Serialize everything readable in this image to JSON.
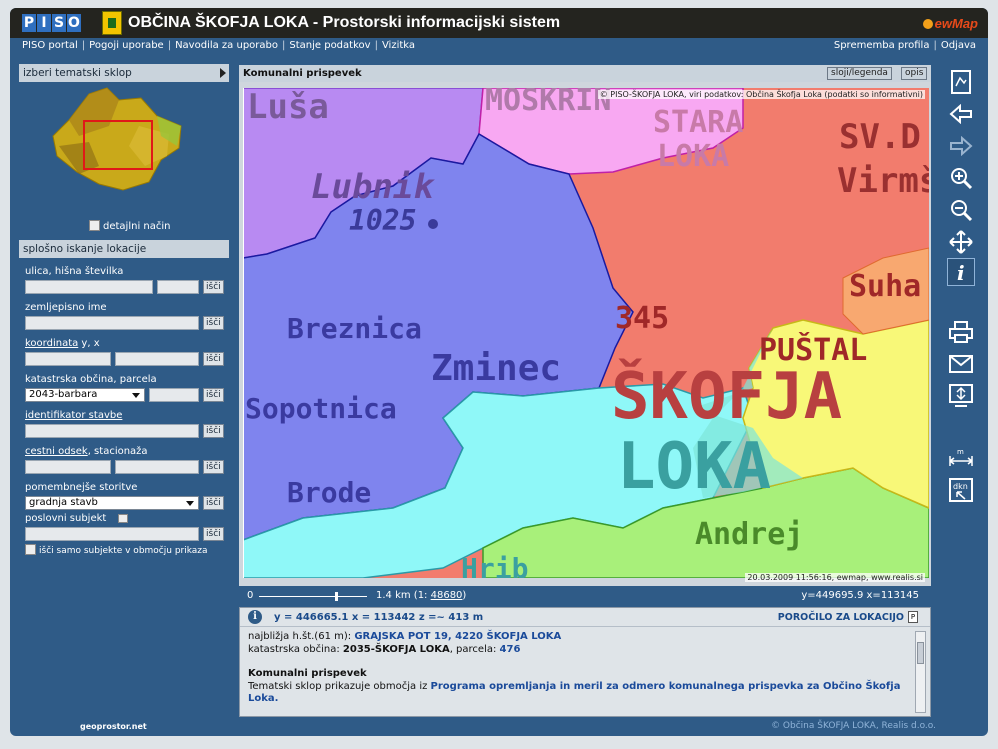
{
  "header": {
    "logo_letters": [
      "P",
      "I",
      "S",
      "O"
    ],
    "title": "OBČINA ŠKOFJA LOKA",
    "subtitle": " - Prostorski informacijski sistem",
    "brand": "ewMap"
  },
  "topnav": {
    "left": [
      "PISO portal",
      "Pogoji uporabe",
      "Navodila za uporabo",
      "Stanje podatkov",
      "Vizitka"
    ],
    "right": [
      "Sprememba profila",
      "Odjava"
    ]
  },
  "left": {
    "thematic_label": "izberi tematski sklop",
    "detail_mode": "detajlni način",
    "search_title": "splošno iskanje lokacije",
    "search_btn": "išči",
    "fields": {
      "street": "ulica, hišna številka",
      "toponym": "zemljepisno ime",
      "coord_link": "koordinata",
      "coord_suffix": " y, x",
      "cadastral": "katastrska občina, parcela",
      "cadastral_value": "2043-barbara",
      "building_id": "identifikator stavbe",
      "road_link": "cestni odsek",
      "road_suffix": ", stacionaža",
      "services": "pomembnejše storitve",
      "services_value": "gradnja stavb",
      "business": "poslovni subjekt",
      "only_area": "išči samo subjekte v območju prikaza"
    }
  },
  "map": {
    "title": "Komunalni prispevek",
    "tab_layers": "sloji/legenda",
    "tab_desc": "opis",
    "copyright": "© PISO-ŠKOFJA LOKA, viri podatkov: Občina Škofja Loka (podatki so informativni)",
    "stamp": "20.03.2009 11:56:16, ewmap, www.realis.si",
    "labels": [
      "Luša",
      "MOSKRIN",
      "STARA",
      "LOKA",
      "SV.D",
      "Virmš",
      "Lubnik",
      "1025",
      "Breznica",
      "Zminec",
      "Sopotnica",
      "345",
      "Suha",
      "PUŠTAL",
      "ŠKOFJA",
      "LOKA",
      "Brode",
      "Andrej",
      "Hrib"
    ]
  },
  "scale": {
    "zero": "0",
    "km": "1.4 km (1: ",
    "ratio": "48680",
    "close": ")",
    "coords": "y=449695.9    x=113145"
  },
  "info": {
    "coords": "y = 446665.1   x = 113442   z =~ 413 m",
    "report": "POROČILO ZA LOKACIJO",
    "nearest_prefix": "najbližja h.št.(61 m): ",
    "nearest_addr": "GRAJSKA POT 19, 4220 ŠKOFJA LOKA",
    "ko_prefix": "katastrska občina: ",
    "ko_value": "2035-ŠKOFJA LOKA",
    "parcel_prefix": ", parcela: ",
    "parcel": "476",
    "section_title": "Komunalni prispevek",
    "section_text": "Tematski sklop prikazuje območja iz ",
    "section_link": "Programa opremljanja in meril za odmero komunalnega prispevka za Občino Škofja Loka."
  },
  "tools": [
    "home-icon",
    "back-icon",
    "forward-icon",
    "zoom-in-icon",
    "zoom-out-icon",
    "pan-icon",
    "info-icon",
    "print-icon",
    "mail-icon",
    "export-icon",
    "measure-icon",
    "dkn-icon"
  ],
  "footer": {
    "geoprostor": "geoprostor.net",
    "copyright": "© Občina ŠKOFJA LOKA, Realis d.o.o."
  }
}
